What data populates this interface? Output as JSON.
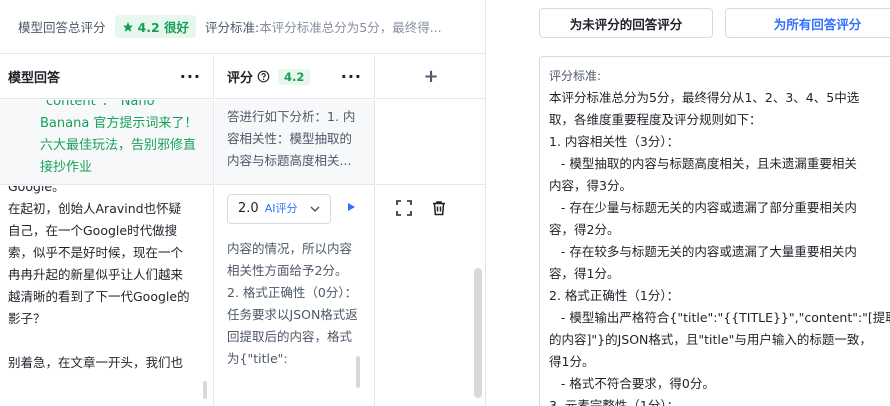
{
  "summary": {
    "title": "模型回答总评分",
    "score": "4.2 很好",
    "criteria_label": "评分标准:",
    "criteria_preview": "本评分标准总分为5分，最终得..."
  },
  "table": {
    "col1": "模型回答",
    "col2": "评分",
    "col2_badge": "4.2",
    "more": "···",
    "add": "+"
  },
  "row1": {
    "answer": "\"content\"：\"Nano Banana 官方提示词来了！六大最佳玩法，告别邪修直接抄作业",
    "reason": "答进行如下分析：1. 内容相关性：模型抽取的内容与标题高度相关..."
  },
  "row2": {
    "answer": "Google。\n在起初，创始人Aravind也怀疑自己，在一个Google时代做搜索，似乎不是好时候，现在一个冉冉升起的新星似乎让人们越来越清晰的看到了下一代Google的影子？\n\n别着急，在文章一开头，我们也",
    "score": "2.0",
    "ai_tag": "AI评分",
    "reason": "内容的情况，所以内容相关性方面给予2分。2. 格式正确性（0分）：任务要求以JSON格式返回提取后的内容，格式为{\"title\":"
  },
  "right": {
    "btn_unscored": "为未评分的回答评分",
    "btn_all": "为所有回答评分",
    "criteria_label": "评分标准:",
    "criteria_lines": [
      "本评分标准总分为5分，最终得分从1、2、3、4、5中选",
      "取，各维度重要程度及评分规则如下：",
      "1. 内容相关性（3分）：",
      "   - 模型抽取的内容与标题高度相关，且未遗漏重要相关",
      "内容，得3分。",
      "   - 存在少量与标题无关的内容或遗漏了部分重要相关内",
      "容，得2分。",
      "   - 存在较多与标题无关的内容或遗漏了大量重要相关内",
      "容，得1分。",
      "2. 格式正确性（1分）：",
      "   - 模型输出严格符合{\"title\":\"{{TITLE}}\",\"content\":\"[提取后",
      "的内容]\"}的JSON格式，且\"title\"与用户输入的标题一致，",
      "得1分。",
      "   - 格式不符合要求，得0分。",
      "3. 元素完整性（1分）："
    ]
  },
  "colors": {
    "accent": "#3370ff",
    "good": "#18a058",
    "border": "#e5e6eb"
  },
  "icons": [
    "star-icon",
    "help-icon",
    "chevron-down-icon",
    "play-icon",
    "fullscreen-icon",
    "trash-icon",
    "plus-icon"
  ]
}
